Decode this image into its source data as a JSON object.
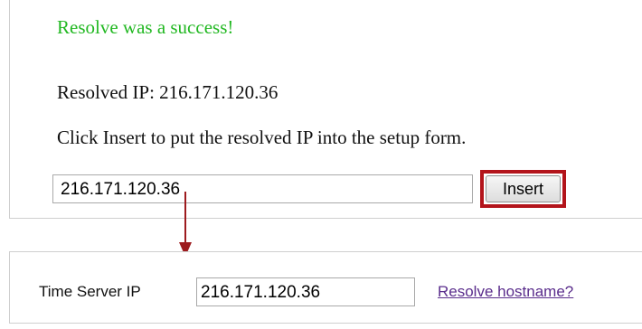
{
  "colors": {
    "success": "#22b822",
    "highlight": "#b3141b",
    "arrow": "#9d1b1e",
    "link": "#5a2d8c"
  },
  "resolve_panel": {
    "status_message": "Resolve was a success!",
    "resolved_ip_line": "Resolved IP: 216.171.120.36",
    "instruction": "Click Insert to put the resolved IP into the setup form.",
    "ip_value": "216.171.120.36",
    "insert_label": "Insert"
  },
  "setup_form": {
    "time_server_label": "Time Server IP",
    "time_server_value": "216.171.120.36",
    "resolve_link_label": "Resolve hostname?"
  },
  "annotation": {
    "arrow_icon": "down-arrow-icon"
  }
}
